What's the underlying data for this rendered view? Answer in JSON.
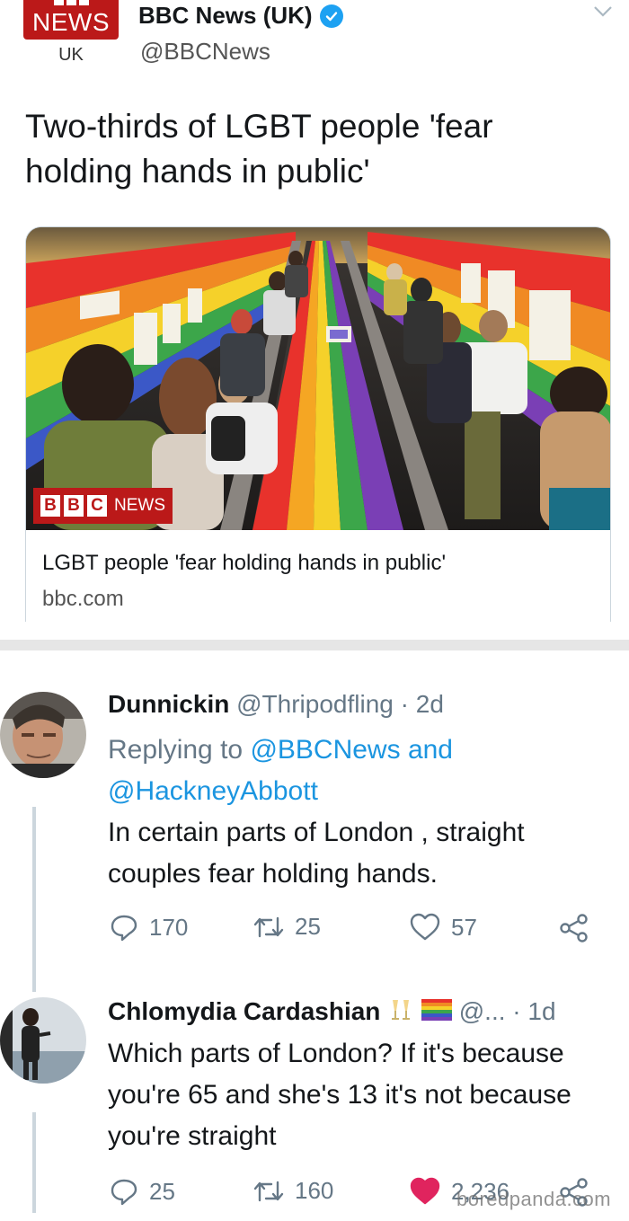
{
  "tweet": {
    "logo_text": "NEWS",
    "logo_sub": "UK",
    "author_name": "BBC News (UK)",
    "author_handle": "@BBCNews",
    "headline_line1": "Two-thirds of LGBT people 'fear",
    "headline_line2": "holding hands in public'",
    "card": {
      "image_badge_letters": [
        "B",
        "B",
        "C"
      ],
      "image_badge_text": "NEWS",
      "title": "LGBT people 'fear holding hands in public'",
      "domain": "bbc.com"
    }
  },
  "replies": [
    {
      "name": "Dunnickin",
      "handle": "@Thripodfling",
      "time": "· 2d",
      "replying_prefix": "Replying to",
      "replying_to_1": "@BBCNews",
      "replying_and": "and",
      "replying_to_2": "@HackneyAbbott",
      "text_line1": "In certain parts of London , straight",
      "text_line2": "couples fear holding hands.",
      "replies_count": "170",
      "retweets_count": "25",
      "likes_count": "57",
      "liked": false
    },
    {
      "name": "Chlomydia Cardashian",
      "handle": "@...",
      "time": "· 1d",
      "text_line1": "Which parts of London? If it's because",
      "text_line2": "you're 65 and she's 13 it's not because",
      "text_line3": "you're straight",
      "replies_count": "25",
      "retweets_count": "160",
      "likes_count": "2,236",
      "liked": true
    }
  ],
  "watermark": "boredpanda.com",
  "colors": {
    "bbc_red": "#bb1919",
    "twitter_blue": "#1da1f2",
    "link_blue": "#1b95e0",
    "muted_gray": "#657786",
    "like_pink": "#e0245e"
  },
  "icons": [
    "verified-badge-icon",
    "chevron-down-icon",
    "reply-icon",
    "retweet-icon",
    "heart-icon",
    "share-icon",
    "champagne-emoji-icon",
    "rainbow-flag-emoji-icon"
  ]
}
